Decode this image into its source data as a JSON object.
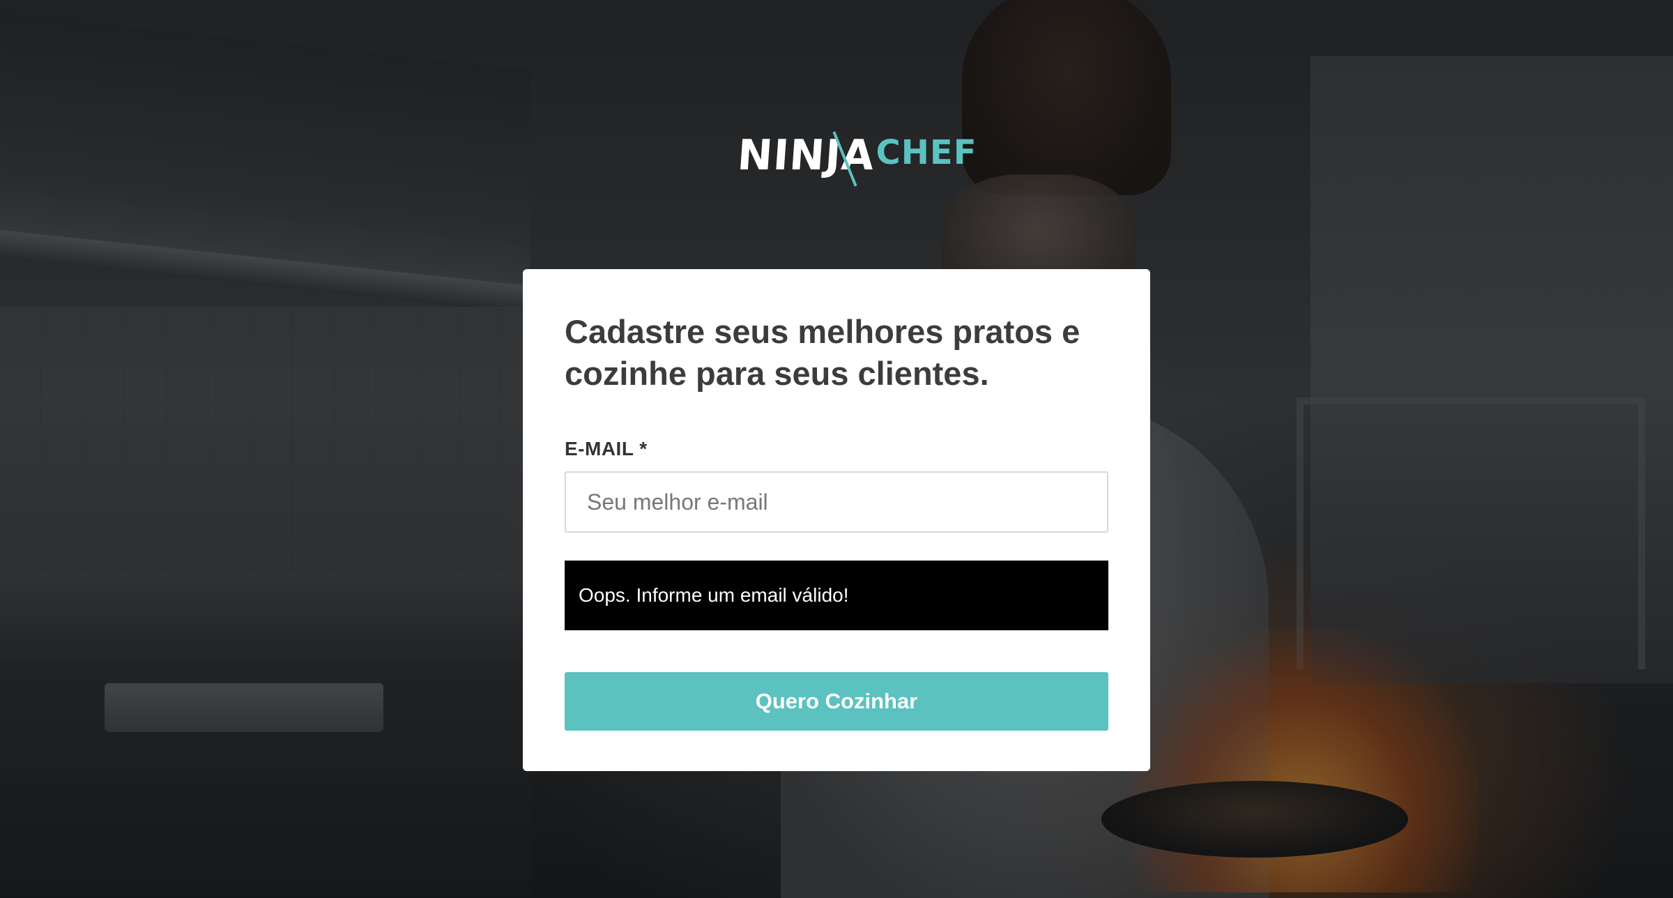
{
  "brand": {
    "logo_part1": "NINJA",
    "logo_part2": "CHEF",
    "accent_color": "#5bc2c0"
  },
  "form": {
    "headline": "Cadastre seus melhores pratos e cozinhe para seus clientes.",
    "email_label": "E-MAIL *",
    "email_placeholder": "Seu melhor e-mail",
    "email_value": "",
    "error_message": "Oops. Informe um email válido!",
    "submit_label": "Quero Cozinhar"
  },
  "colors": {
    "card_background": "#ffffff",
    "error_background": "#000000",
    "button_background": "#5bc2c0"
  }
}
